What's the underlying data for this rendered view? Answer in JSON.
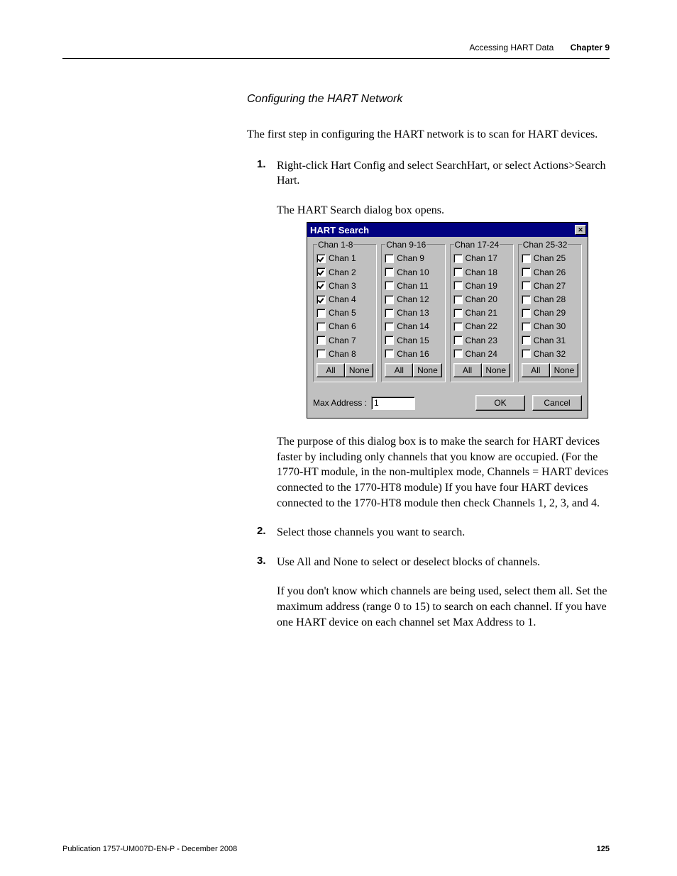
{
  "header": {
    "breadcrumb": "Accessing HART Data",
    "chapter": "Chapter 9"
  },
  "section_title": "Configuring the HART Network",
  "intro": "The first step in configuring the HART network is to scan for HART devices.",
  "steps": [
    {
      "num": "1.",
      "text": "Right-click Hart Config and select SearchHart, or select Actions>Search Hart.",
      "sub": "The HART Search dialog box opens.",
      "after_dialog": "The purpose of this dialog box is to make the search for HART devices faster by including only channels that you know are occupied. (For the 1770-HT module, in the non-multiplex mode, Channels = HART devices connected to the 1770-HT8 module) If you have four HART devices connected to the 1770-HT8 module then check Channels 1, 2, 3, and 4."
    },
    {
      "num": "2.",
      "text": "Select those channels you want to search."
    },
    {
      "num": "3.",
      "text": "Use All and None to select or deselect blocks of channels.",
      "sub": "If you don't know which channels are being used, select them all. Set the maximum address (range 0 to 15) to search on each channel. If you have one HART device on each channel set Max Address to 1."
    }
  ],
  "dialog": {
    "title": "HART Search",
    "groups": [
      {
        "legend": "Chan 1-8",
        "items": [
          {
            "label": "Chan 1",
            "checked": true
          },
          {
            "label": "Chan 2",
            "checked": true
          },
          {
            "label": "Chan 3",
            "checked": true
          },
          {
            "label": "Chan 4",
            "checked": true
          },
          {
            "label": "Chan 5",
            "checked": false
          },
          {
            "label": "Chan 6",
            "checked": false
          },
          {
            "label": "Chan 7",
            "checked": false
          },
          {
            "label": "Chan 8",
            "checked": false
          }
        ]
      },
      {
        "legend": "Chan 9-16",
        "items": [
          {
            "label": "Chan 9",
            "checked": false
          },
          {
            "label": "Chan 10",
            "checked": false
          },
          {
            "label": "Chan 11",
            "checked": false
          },
          {
            "label": "Chan 12",
            "checked": false
          },
          {
            "label": "Chan 13",
            "checked": false
          },
          {
            "label": "Chan 14",
            "checked": false
          },
          {
            "label": "Chan 15",
            "checked": false
          },
          {
            "label": "Chan 16",
            "checked": false
          }
        ]
      },
      {
        "legend": "Chan 17-24",
        "items": [
          {
            "label": "Chan 17",
            "checked": false
          },
          {
            "label": "Chan 18",
            "checked": false
          },
          {
            "label": "Chan 19",
            "checked": false
          },
          {
            "label": "Chan 20",
            "checked": false
          },
          {
            "label": "Chan 21",
            "checked": false
          },
          {
            "label": "Chan 22",
            "checked": false
          },
          {
            "label": "Chan 23",
            "checked": false
          },
          {
            "label": "Chan 24",
            "checked": false
          }
        ]
      },
      {
        "legend": "Chan 25-32",
        "items": [
          {
            "label": "Chan 25",
            "checked": false
          },
          {
            "label": "Chan 26",
            "checked": false
          },
          {
            "label": "Chan 27",
            "checked": false
          },
          {
            "label": "Chan 28",
            "checked": false
          },
          {
            "label": "Chan 29",
            "checked": false
          },
          {
            "label": "Chan 30",
            "checked": false
          },
          {
            "label": "Chan 31",
            "checked": false
          },
          {
            "label": "Chan 32",
            "checked": false
          }
        ]
      }
    ],
    "all_label": "All",
    "none_label": "None",
    "max_addr_label": "Max Address :",
    "max_addr_value": "1",
    "ok_label": "OK",
    "cancel_label": "Cancel"
  },
  "footer": {
    "pub": "Publication 1757-UM007D-EN-P - December 2008",
    "page": "125"
  }
}
